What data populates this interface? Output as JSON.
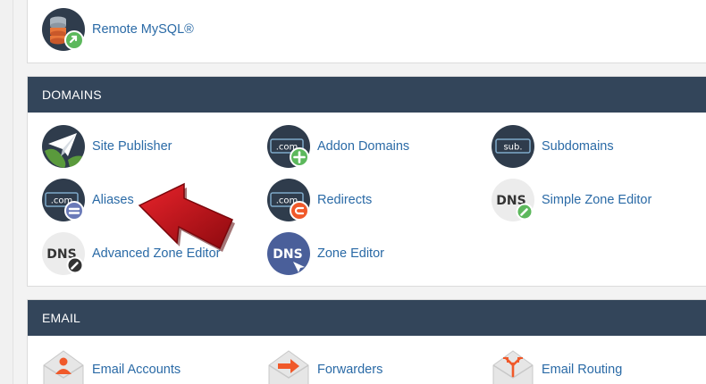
{
  "top_section": {
    "items": [
      {
        "label": "Remote MySQL®",
        "icon": "remote-mysql-icon"
      }
    ]
  },
  "domains": {
    "title": "DOMAINS",
    "items": [
      {
        "label": "Site Publisher",
        "icon": "site-publisher-icon"
      },
      {
        "label": "Addon Domains",
        "icon": "addon-domains-icon",
        "icon_text": ".com"
      },
      {
        "label": "Subdomains",
        "icon": "subdomains-icon",
        "icon_text": "sub."
      },
      {
        "label": "Aliases",
        "icon": "aliases-icon",
        "icon_text": ".com"
      },
      {
        "label": "Redirects",
        "icon": "redirects-icon",
        "icon_text": ".com"
      },
      {
        "label": "Simple Zone Editor",
        "icon": "simple-zone-editor-icon",
        "icon_text": "DNS"
      },
      {
        "label": "Advanced Zone Editor",
        "icon": "advanced-zone-editor-icon",
        "icon_text": "DNS"
      },
      {
        "label": "Zone Editor",
        "icon": "zone-editor-icon",
        "icon_text": "DNS"
      }
    ]
  },
  "email": {
    "title": "EMAIL",
    "items": [
      {
        "label": "Email Accounts",
        "icon": "email-accounts-icon"
      },
      {
        "label": "Forwarders",
        "icon": "forwarders-icon"
      },
      {
        "label": "Email Routing",
        "icon": "email-routing-icon"
      }
    ]
  },
  "colors": {
    "header_bg": "#33455a",
    "link": "#2a6aa6",
    "icon_dark": "#2f3c4c",
    "accent_green": "#5cb85c",
    "accent_orange": "#f0592a",
    "arrow_red": "#c8141b"
  }
}
